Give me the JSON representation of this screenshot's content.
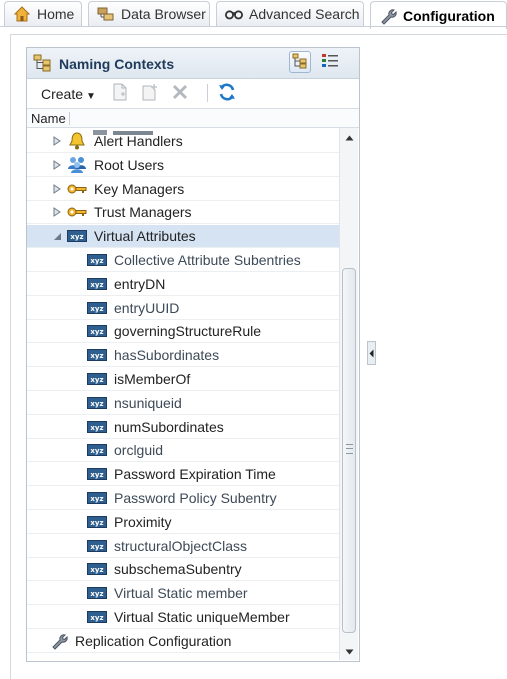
{
  "tabs": [
    {
      "label": "Home",
      "icon": "home-icon",
      "active": false
    },
    {
      "label": "Data Browser",
      "icon": "data-browser-icon",
      "active": false
    },
    {
      "label": "Advanced Search",
      "icon": "binoculars-icon",
      "active": false
    },
    {
      "label": "Configuration",
      "icon": "wrench-icon",
      "active": true
    }
  ],
  "panel": {
    "title": "Naming Contexts",
    "views": [
      "tree-view-icon",
      "list-view-icon"
    ],
    "toolbar": {
      "create_label": "Create",
      "buttons": [
        "new-entry-icon",
        "new-child-icon",
        "delete-icon",
        "refresh-icon"
      ]
    },
    "column_header": "Name"
  },
  "tree": {
    "rows": [
      {
        "label": "Alert Handlers",
        "icon": "bell-icon",
        "expander": "collapsed",
        "level": 1
      },
      {
        "label": "Root Users",
        "icon": "users-icon",
        "expander": "collapsed",
        "level": 1
      },
      {
        "label": "Key Managers",
        "icon": "key-icon",
        "expander": "collapsed",
        "level": 1
      },
      {
        "label": "Trust Managers",
        "icon": "key-icon",
        "expander": "collapsed",
        "level": 1
      },
      {
        "label": "Virtual Attributes",
        "icon": "xyz-icon",
        "expander": "expanded",
        "level": 1,
        "selected": true
      },
      {
        "label": "Collective Attribute Subentries",
        "icon": "xyz-icon",
        "level": 2
      },
      {
        "label": "entryDN",
        "icon": "xyz-icon",
        "level": 2
      },
      {
        "label": "entryUUID",
        "icon": "xyz-icon",
        "level": 2
      },
      {
        "label": "governingStructureRule",
        "icon": "xyz-icon",
        "level": 2
      },
      {
        "label": "hasSubordinates",
        "icon": "xyz-icon",
        "level": 2
      },
      {
        "label": "isMemberOf",
        "icon": "xyz-icon",
        "level": 2
      },
      {
        "label": "nsuniqueid",
        "icon": "xyz-icon",
        "level": 2
      },
      {
        "label": "numSubordinates",
        "icon": "xyz-icon",
        "level": 2
      },
      {
        "label": "orclguid",
        "icon": "xyz-icon",
        "level": 2
      },
      {
        "label": "Password Expiration Time",
        "icon": "xyz-icon",
        "level": 2
      },
      {
        "label": "Password Policy Subentry",
        "icon": "xyz-icon",
        "level": 2
      },
      {
        "label": "Proximity",
        "icon": "xyz-icon",
        "level": 2
      },
      {
        "label": "structuralObjectClass",
        "icon": "xyz-icon",
        "level": 2
      },
      {
        "label": "subschemaSubentry",
        "icon": "xyz-icon",
        "level": 2
      },
      {
        "label": "Virtual Static member",
        "icon": "xyz-icon",
        "level": 2
      },
      {
        "label": "Virtual Static uniqueMember",
        "icon": "xyz-icon",
        "level": 2
      },
      {
        "label": "Replication Configuration",
        "icon": "wrench-icon",
        "level": 0
      }
    ]
  },
  "colors": {
    "selected_row": "#d6e3f3",
    "panel_title": "#1f3a5b",
    "refresh_blue": "#1e77c9"
  }
}
